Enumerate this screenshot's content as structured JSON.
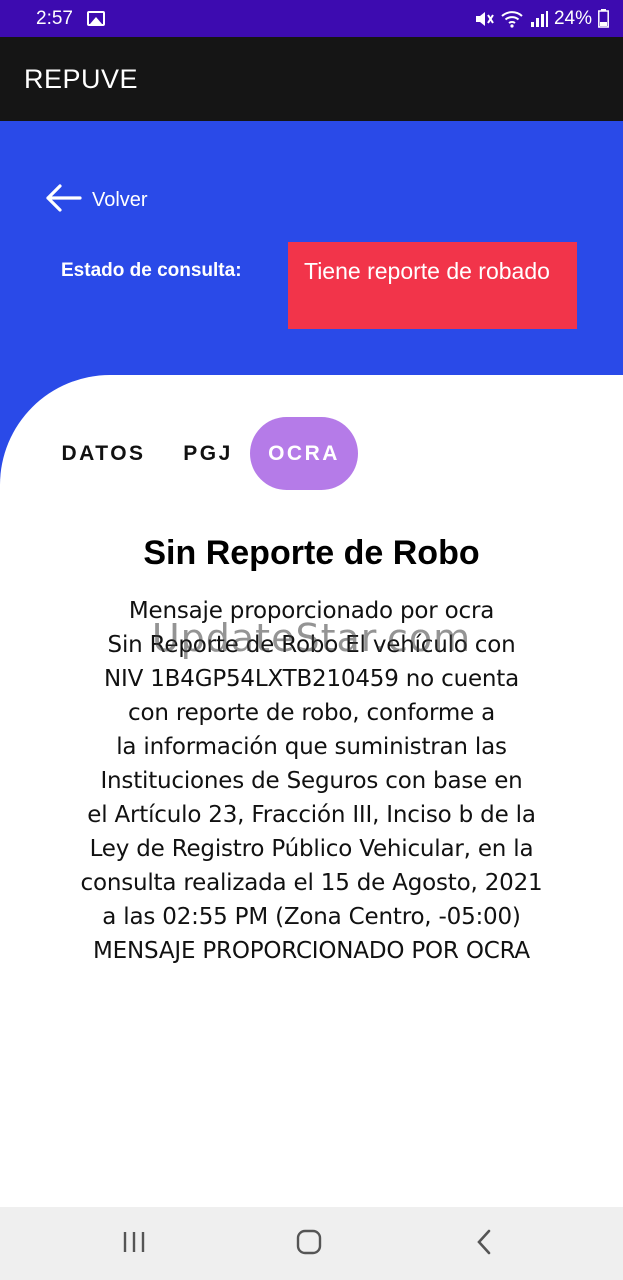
{
  "status_bar": {
    "time": "2:57",
    "battery": "24%",
    "icons": [
      "image-icon",
      "mute-icon",
      "wifi-icon",
      "signal-icon",
      "battery-icon"
    ]
  },
  "app_bar": {
    "title": "REPUVE"
  },
  "header": {
    "back_label": "Volver",
    "estado_label": "Estado de consulta:",
    "estado_value": "Tiene reporte de robado"
  },
  "tabs": [
    {
      "label": "DATOS",
      "active": false
    },
    {
      "label": "PGJ",
      "active": false
    },
    {
      "label": "OCRA",
      "active": true
    }
  ],
  "result": {
    "title": "Sin Reporte de Robo",
    "lines": [
      "Mensaje proporcionado por ocra",
      "Sin Reporte de Robo El vehículo con",
      "NIV 1B4GP54LXTB210459 no cuenta",
      "con reporte de robo, conforme a",
      "la información que suministran las",
      "Instituciones de Seguros con base en",
      "el Artículo 23, Fracción III, Inciso b de la",
      "Ley de Registro Público Vehicular, en la",
      "consulta realizada el 15 de Agosto, 2021",
      "a las 02:55 PM (Zona Centro, -05:00)",
      "MENSAJE PROPORCIONADO POR OCRA"
    ]
  },
  "watermark": "UpdateStar.com",
  "colors": {
    "status_bar": "#3d0bb0",
    "app_bar": "#151515",
    "hero": "#2a4ae8",
    "estado_box": "#f2344a",
    "active_tab": "#b57be8",
    "nav_bar": "#efefef"
  }
}
